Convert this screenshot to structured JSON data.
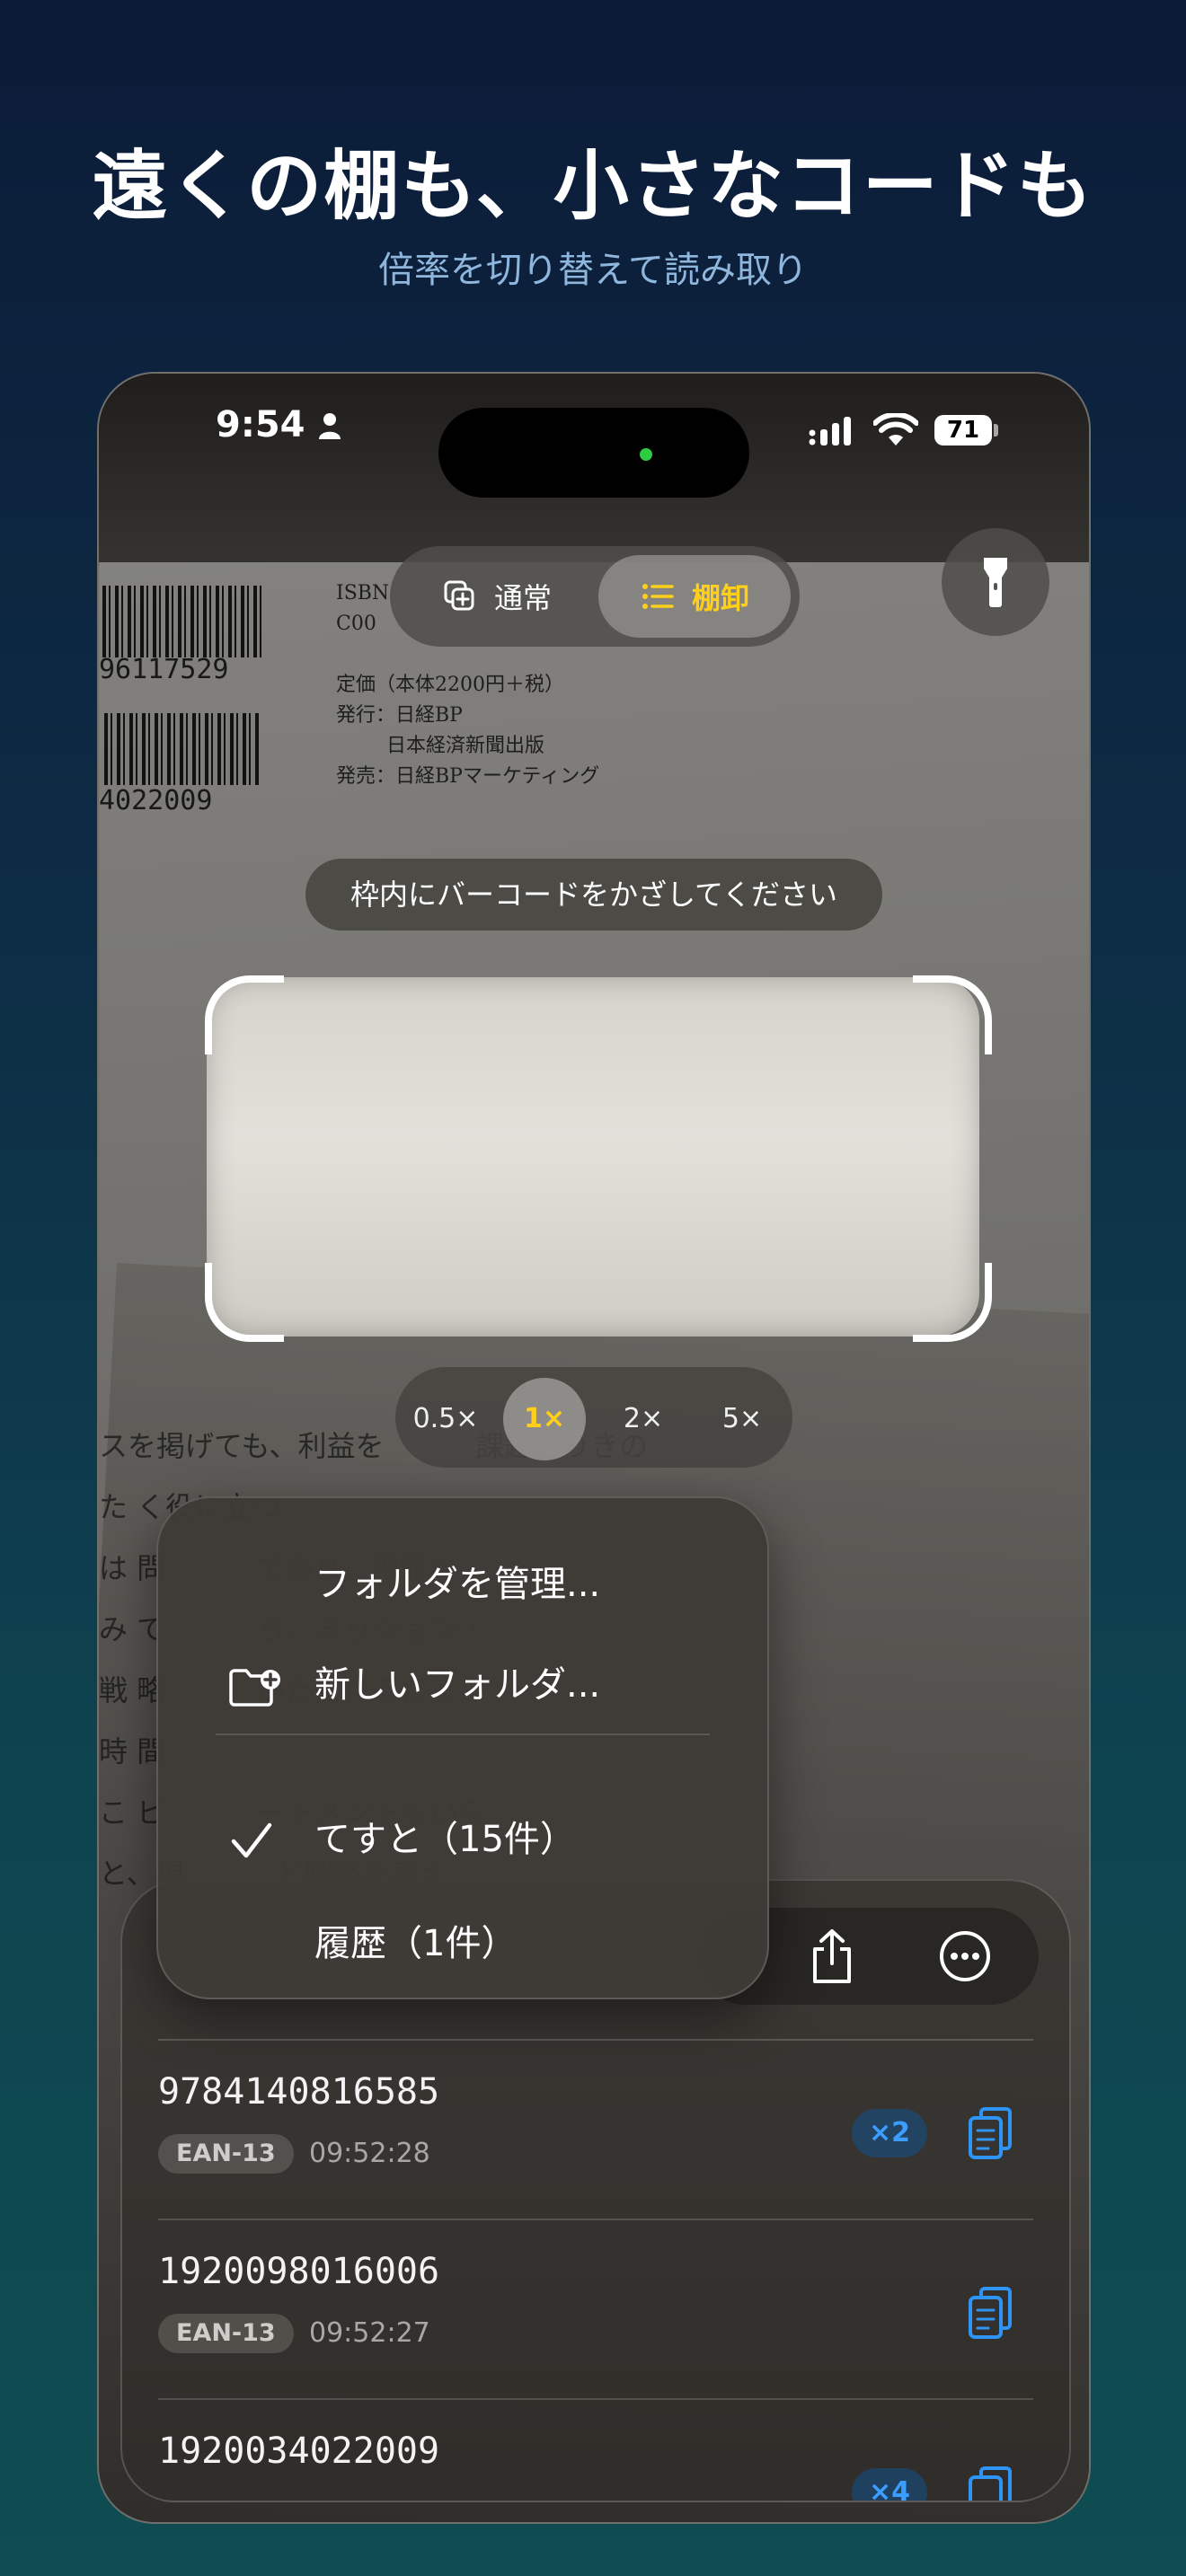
{
  "promo": {
    "headline": "遠くの棚も、小さなコードも",
    "subline": "倍率を切り替えて読み取り"
  },
  "status_bar": {
    "time": "9:54",
    "battery": "71"
  },
  "background_text": {
    "barcode_number_1": "96117529",
    "barcode_number_2": "4022009",
    "book_top": "ISBN\nC00\n\n定価（本体2200円＋税）\n発行：日経BP\n        日本経済新聞出版\n発売：日経BPマーケティング",
    "book_body": "スを掲げても、利益を          課題ありきの\nた く役に立つ\nは 問          であり、困難な\nみ て          ら、ミッション・\n戦 略          いただけるだろ\n時 間\nこ ビ          ートメントもいら\nと、現          と戦略を考え"
  },
  "mode_switch": {
    "normal": "通常",
    "shelf": "棚卸",
    "selected": "shelf"
  },
  "scanner": {
    "hint": "枠内にバーコードをかざしてください"
  },
  "zoom": {
    "options": [
      "0.5×",
      "1×",
      "2×",
      "5×"
    ],
    "selected": "1×"
  },
  "folder_menu": {
    "manage": "フォルダを管理...",
    "new_folder": "新しいフォルダ...",
    "folders": [
      {
        "label": "てすと（15件）",
        "checked": true
      },
      {
        "label": "履歴（1件）",
        "checked": false
      }
    ]
  },
  "scan_list": [
    {
      "code": "9784140816585",
      "type": "EAN-13",
      "time": "09:52:28",
      "count": "×2"
    },
    {
      "code": "1920098016006",
      "type": "EAN-13",
      "time": "09:52:27",
      "count": ""
    },
    {
      "code": "1920034022009",
      "type": "",
      "time": "",
      "count": "×4"
    }
  ],
  "colors": {
    "accent_yellow": "#ffcf1a",
    "accent_blue": "#3a9dff"
  }
}
